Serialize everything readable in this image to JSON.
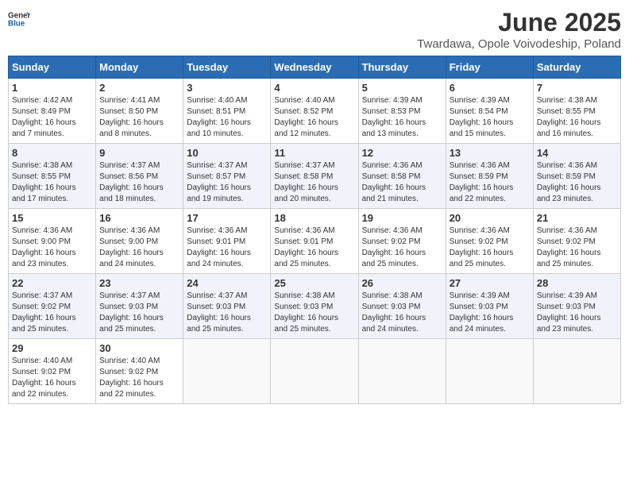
{
  "logo": {
    "text_general": "General",
    "text_blue": "Blue"
  },
  "title": "June 2025",
  "subtitle": "Twardawa, Opole Voivodeship, Poland",
  "days_of_week": [
    "Sunday",
    "Monday",
    "Tuesday",
    "Wednesday",
    "Thursday",
    "Friday",
    "Saturday"
  ],
  "weeks": [
    [
      {
        "day": 1,
        "sunrise": "4:42 AM",
        "sunset": "8:49 PM",
        "daylight": "16 hours and 7 minutes."
      },
      {
        "day": 2,
        "sunrise": "4:41 AM",
        "sunset": "8:50 PM",
        "daylight": "16 hours and 8 minutes."
      },
      {
        "day": 3,
        "sunrise": "4:40 AM",
        "sunset": "8:51 PM",
        "daylight": "16 hours and 10 minutes."
      },
      {
        "day": 4,
        "sunrise": "4:40 AM",
        "sunset": "8:52 PM",
        "daylight": "16 hours and 12 minutes."
      },
      {
        "day": 5,
        "sunrise": "4:39 AM",
        "sunset": "8:53 PM",
        "daylight": "16 hours and 13 minutes."
      },
      {
        "day": 6,
        "sunrise": "4:39 AM",
        "sunset": "8:54 PM",
        "daylight": "16 hours and 15 minutes."
      },
      {
        "day": 7,
        "sunrise": "4:38 AM",
        "sunset": "8:55 PM",
        "daylight": "16 hours and 16 minutes."
      }
    ],
    [
      {
        "day": 8,
        "sunrise": "4:38 AM",
        "sunset": "8:55 PM",
        "daylight": "16 hours and 17 minutes."
      },
      {
        "day": 9,
        "sunrise": "4:37 AM",
        "sunset": "8:56 PM",
        "daylight": "16 hours and 18 minutes."
      },
      {
        "day": 10,
        "sunrise": "4:37 AM",
        "sunset": "8:57 PM",
        "daylight": "16 hours and 19 minutes."
      },
      {
        "day": 11,
        "sunrise": "4:37 AM",
        "sunset": "8:58 PM",
        "daylight": "16 hours and 20 minutes."
      },
      {
        "day": 12,
        "sunrise": "4:36 AM",
        "sunset": "8:58 PM",
        "daylight": "16 hours and 21 minutes."
      },
      {
        "day": 13,
        "sunrise": "4:36 AM",
        "sunset": "8:59 PM",
        "daylight": "16 hours and 22 minutes."
      },
      {
        "day": 14,
        "sunrise": "4:36 AM",
        "sunset": "8:59 PM",
        "daylight": "16 hours and 23 minutes."
      }
    ],
    [
      {
        "day": 15,
        "sunrise": "4:36 AM",
        "sunset": "9:00 PM",
        "daylight": "16 hours and 23 minutes."
      },
      {
        "day": 16,
        "sunrise": "4:36 AM",
        "sunset": "9:00 PM",
        "daylight": "16 hours and 24 minutes."
      },
      {
        "day": 17,
        "sunrise": "4:36 AM",
        "sunset": "9:01 PM",
        "daylight": "16 hours and 24 minutes."
      },
      {
        "day": 18,
        "sunrise": "4:36 AM",
        "sunset": "9:01 PM",
        "daylight": "16 hours and 25 minutes."
      },
      {
        "day": 19,
        "sunrise": "4:36 AM",
        "sunset": "9:02 PM",
        "daylight": "16 hours and 25 minutes."
      },
      {
        "day": 20,
        "sunrise": "4:36 AM",
        "sunset": "9:02 PM",
        "daylight": "16 hours and 25 minutes."
      },
      {
        "day": 21,
        "sunrise": "4:36 AM",
        "sunset": "9:02 PM",
        "daylight": "16 hours and 25 minutes."
      }
    ],
    [
      {
        "day": 22,
        "sunrise": "4:37 AM",
        "sunset": "9:02 PM",
        "daylight": "16 hours and 25 minutes."
      },
      {
        "day": 23,
        "sunrise": "4:37 AM",
        "sunset": "9:03 PM",
        "daylight": "16 hours and 25 minutes."
      },
      {
        "day": 24,
        "sunrise": "4:37 AM",
        "sunset": "9:03 PM",
        "daylight": "16 hours and 25 minutes."
      },
      {
        "day": 25,
        "sunrise": "4:38 AM",
        "sunset": "9:03 PM",
        "daylight": "16 hours and 25 minutes."
      },
      {
        "day": 26,
        "sunrise": "4:38 AM",
        "sunset": "9:03 PM",
        "daylight": "16 hours and 24 minutes."
      },
      {
        "day": 27,
        "sunrise": "4:39 AM",
        "sunset": "9:03 PM",
        "daylight": "16 hours and 24 minutes."
      },
      {
        "day": 28,
        "sunrise": "4:39 AM",
        "sunset": "9:03 PM",
        "daylight": "16 hours and 23 minutes."
      }
    ],
    [
      {
        "day": 29,
        "sunrise": "4:40 AM",
        "sunset": "9:02 PM",
        "daylight": "16 hours and 22 minutes."
      },
      {
        "day": 30,
        "sunrise": "4:40 AM",
        "sunset": "9:02 PM",
        "daylight": "16 hours and 22 minutes."
      },
      null,
      null,
      null,
      null,
      null
    ]
  ],
  "labels": {
    "sunrise": "Sunrise:",
    "sunset": "Sunset:",
    "daylight": "Daylight:"
  }
}
